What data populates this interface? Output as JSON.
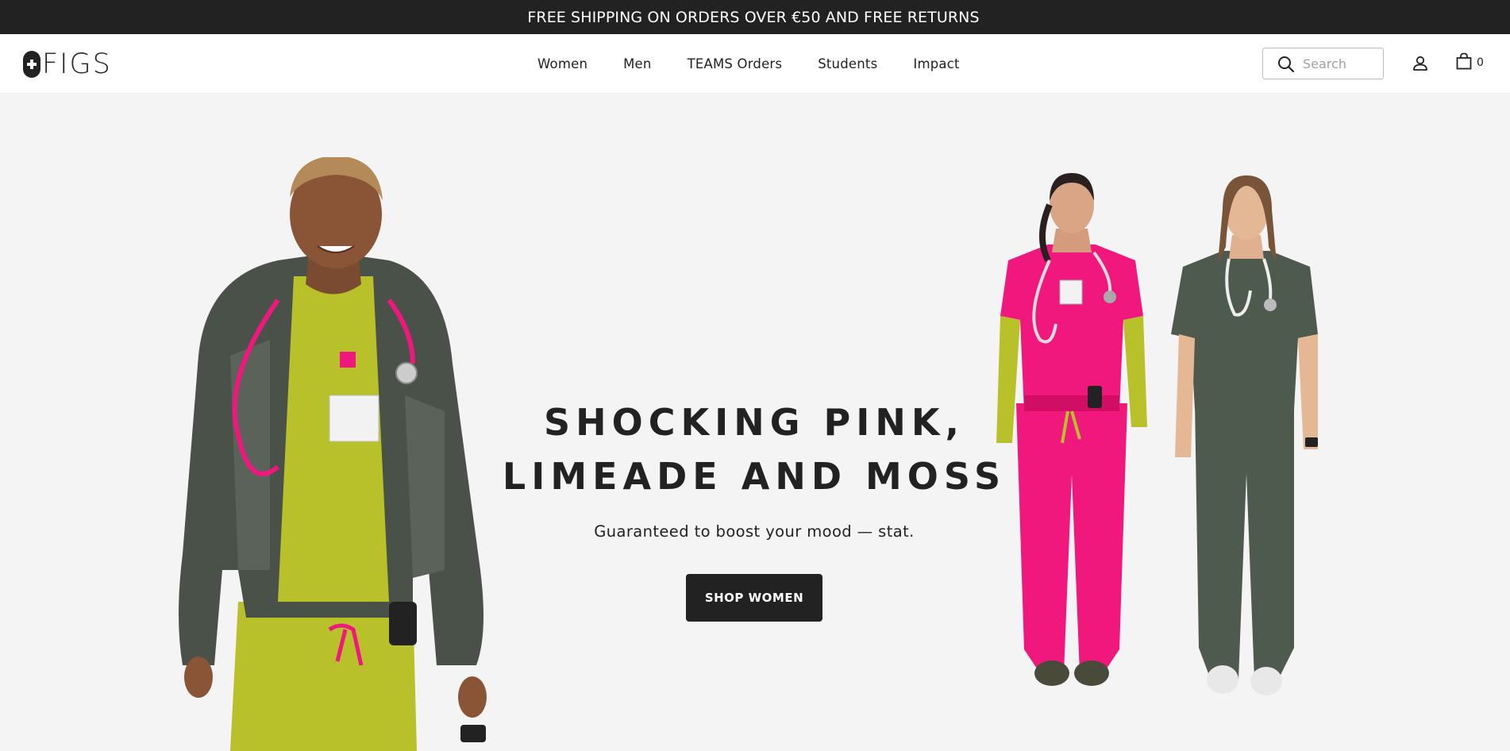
{
  "announcement": "FREE SHIPPING ON ORDERS OVER €50 AND FREE RETURNS",
  "brand": {
    "name": "FIGS"
  },
  "nav": {
    "items": [
      {
        "label": "Women"
      },
      {
        "label": "Men"
      },
      {
        "label": "TEAMS Orders"
      },
      {
        "label": "Students"
      },
      {
        "label": "Impact"
      }
    ]
  },
  "search": {
    "placeholder": "Search",
    "value": ""
  },
  "cart": {
    "count": "0"
  },
  "hero": {
    "title_line1": "SHOCKING PINK,",
    "title_line2": "LIMEADE AND MOSS",
    "subtitle": "Guaranteed to boost your mood — stat.",
    "cta": "SHOP WOMEN"
  },
  "colors": {
    "dark": "#222222",
    "background": "#f4f4f4",
    "pink": "#f0177d",
    "limeade": "#b8c02a",
    "moss": "#4f5a4e",
    "fleece": "#4a5148"
  }
}
